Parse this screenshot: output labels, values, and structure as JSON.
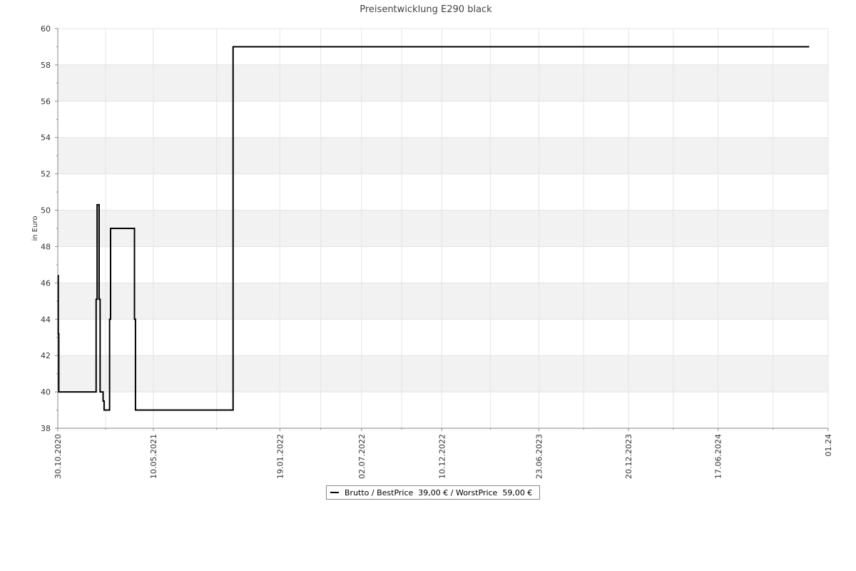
{
  "chart_data": {
    "type": "line",
    "step": true,
    "title": "Preisentwicklung E290 black",
    "xlabel": "",
    "ylabel": "in Euro",
    "ylim": [
      38,
      60
    ],
    "xlim": [
      "2020-10-30",
      "2025-01-24"
    ],
    "y_ticks": [
      38,
      40,
      42,
      44,
      46,
      48,
      50,
      52,
      54,
      56,
      58,
      60
    ],
    "x_ticks": [
      {
        "date": "2020-10-30",
        "label": "30.10.2020"
      },
      {
        "date": "2021-05-10",
        "label": "10.05.2021"
      },
      {
        "date": "2022-01-19",
        "label": "19.01.2022"
      },
      {
        "date": "2022-07-02",
        "label": "02.07.2022"
      },
      {
        "date": "2022-12-10",
        "label": "10.12.2022"
      },
      {
        "date": "2023-06-23",
        "label": "23.06.2023"
      },
      {
        "date": "2023-12-20",
        "label": "20.12.2023"
      },
      {
        "date": "2024-06-17",
        "label": "17.06.2024"
      },
      {
        "date": "2025-01-24",
        "label": "01.24"
      }
    ],
    "grid": true,
    "banded_background": true,
    "legend_position": "bottom-center",
    "series": [
      {
        "name": "Brutto / BestPrice  39,00 € / WorstPrice  59,00 €",
        "color": "#000000",
        "points": [
          {
            "x": "2020-10-30",
            "y": 46.4
          },
          {
            "x": "2020-10-31",
            "y": 43.2
          },
          {
            "x": "2020-11-01",
            "y": 40.0
          },
          {
            "x": "2021-01-15",
            "y": 45.1
          },
          {
            "x": "2021-01-17",
            "y": 50.3
          },
          {
            "x": "2021-01-21",
            "y": 45.1
          },
          {
            "x": "2021-01-23",
            "y": 40.0
          },
          {
            "x": "2021-01-29",
            "y": 39.5
          },
          {
            "x": "2021-01-31",
            "y": 39.0
          },
          {
            "x": "2021-02-11",
            "y": 44.0
          },
          {
            "x": "2021-02-13",
            "y": 49.0
          },
          {
            "x": "2021-04-02",
            "y": 44.0
          },
          {
            "x": "2021-04-04",
            "y": 39.0
          },
          {
            "x": "2021-10-17",
            "y": 59.0
          },
          {
            "x": "2024-12-17",
            "y": 59.0
          }
        ]
      }
    ]
  }
}
